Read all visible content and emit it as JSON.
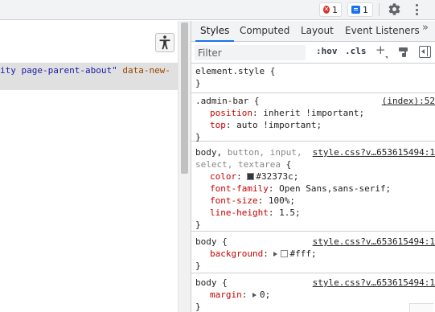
{
  "toolbar": {
    "errors_count": "1",
    "messages_count": "1",
    "icons": [
      "error-icon",
      "message-icon",
      "gear-icon",
      "kebab-menu-icon"
    ]
  },
  "elements": {
    "code_text": "ity page-parent-about\"",
    "code_attr": "data-new-"
  },
  "tabs": [
    {
      "label": "Styles",
      "active": true
    },
    {
      "label": "Computed",
      "active": false
    },
    {
      "label": "Layout",
      "active": false
    },
    {
      "label": "Event Listeners",
      "active": false
    }
  ],
  "tab_more": "»",
  "filter": {
    "placeholder": "Filter",
    "hov": ":hov",
    "cls": ".cls",
    "plus": "+"
  },
  "rules": [
    {
      "selector": "element.style {",
      "close": "}"
    },
    {
      "selector": ".admin-bar {",
      "source": "(index):52",
      "props": [
        {
          "name": "position",
          "value": "inherit !important;"
        },
        {
          "name": "top",
          "value": "auto !important;"
        }
      ],
      "close": "}"
    },
    {
      "selector_main": "body, ",
      "selector_dim": "button, input,",
      "selector_line2_dim": "select, textarea",
      "selector_line2_tail": " {",
      "source": "style.css?v…653615494:1",
      "props": [
        {
          "name": "color",
          "value": "#32373c;",
          "swatch": "#32373c"
        },
        {
          "name": "font-family",
          "value": "Open Sans,sans-serif;"
        },
        {
          "name": "font-size",
          "value": "100%;"
        },
        {
          "name": "line-height",
          "value": "1.5;"
        }
      ],
      "close": "}"
    },
    {
      "selector": "body {",
      "source": "style.css?v…653615494:1",
      "props": [
        {
          "name": "background",
          "value": "#fff;",
          "swatch": "#ffffff"
        }
      ],
      "close": "}"
    },
    {
      "selector": "body {",
      "source": "style.css?v…653615494:1",
      "props": [
        {
          "name": "margin",
          "value": "0;"
        }
      ],
      "close": "}"
    }
  ],
  "colors": {
    "accent": "#1a73e8",
    "error": "#d93025",
    "prop_name": "#c80000",
    "selection_bg": "#e0e0e0"
  }
}
